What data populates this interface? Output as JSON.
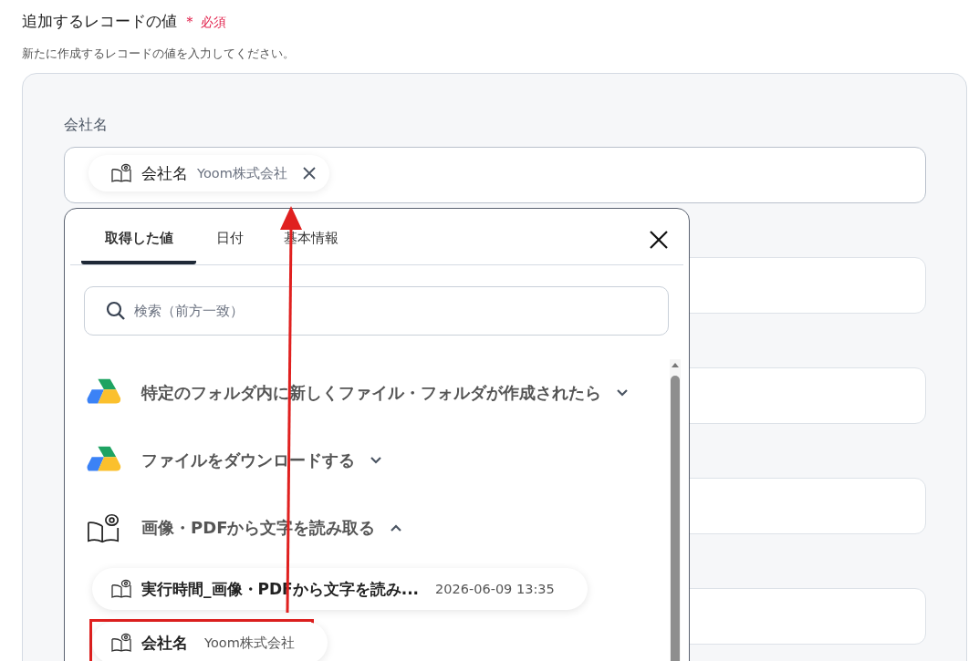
{
  "section": {
    "title": "追加するレコードの値",
    "required_mark": "＊",
    "required_label": "必須",
    "description": "新たに作成するレコードの値を入力してください。"
  },
  "fields": [
    {
      "kind": "chip",
      "label": "会社名",
      "chip": {
        "name": "会社名",
        "value": "Yoom株式会社"
      }
    },
    {
      "kind": "empty"
    },
    {
      "kind": "empty"
    },
    {
      "kind": "empty"
    },
    {
      "kind": "empty"
    }
  ],
  "popup": {
    "tabs": [
      {
        "label": "取得した値",
        "selected": true
      },
      {
        "label": "日付",
        "selected": false
      },
      {
        "label": "基本情報",
        "selected": false
      }
    ],
    "search": {
      "placeholder": "検索（前方一致）"
    },
    "groups": [
      {
        "kind": "drive",
        "title": "特定のフォルダ内に新しくファイル・フォルダが作成されたら",
        "expanded": false
      },
      {
        "kind": "drive",
        "title": "ファイルをダウンロードする",
        "expanded": false
      },
      {
        "kind": "ocr",
        "title": "画像・PDFから文字を読み取る",
        "expanded": true,
        "children": [
          {
            "name": "実行時間_画像・PDFから文字を読み...",
            "value": "2026-06-09 13:35",
            "highlighted": false
          },
          {
            "name": "会社名",
            "value": "Yoom株式会社",
            "highlighted": true
          }
        ]
      }
    ]
  }
}
